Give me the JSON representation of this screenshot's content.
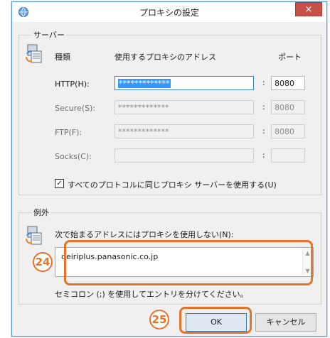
{
  "window": {
    "title": "プロキシの設定",
    "close_glyph": "×"
  },
  "servers": {
    "group_label": "サーバー",
    "col_type": "種類",
    "col_address": "使用するプロキシのアドレス",
    "col_port": "ポート",
    "rows": [
      {
        "label": "HTTP(H):",
        "address": "*************",
        "port": "8080",
        "enabled": true
      },
      {
        "label": "Secure(S):",
        "address": "*************",
        "port": "8080",
        "enabled": false
      },
      {
        "label": "FTP(F):",
        "address": "*************",
        "port": "8080",
        "enabled": false
      },
      {
        "label": "Socks(C):",
        "address": "",
        "port": "",
        "enabled": false
      }
    ],
    "colon": ":",
    "same_proxy_label": "すべてのプロトコルに同じプロキシ サーバーを使用する(U)",
    "same_proxy_checked": true,
    "check_glyph": "✓"
  },
  "exceptions": {
    "group_label": "例外",
    "instruction": "次で始まるアドレスにはプロキシを使用しない(N):",
    "value": "deiriplus.panasonic.co.jp",
    "hint": "セミコロン (;) を使用してエントリを分けてください。"
  },
  "buttons": {
    "ok": "OK",
    "cancel": "キャンセル"
  },
  "annotations": {
    "badge_24": "24",
    "badge_25": "25",
    "accent_color": "#e8732a"
  }
}
